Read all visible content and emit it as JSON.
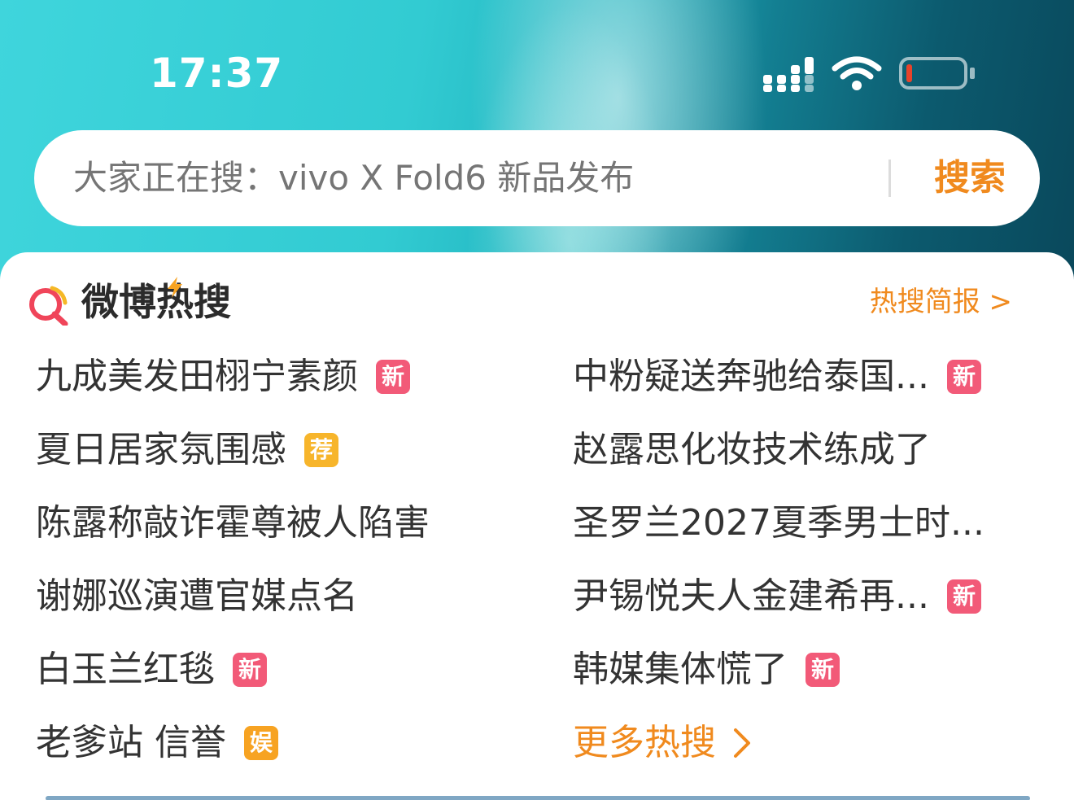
{
  "status_bar": {
    "time": "17:37",
    "icons": [
      "cellular-signal-icon",
      "wifi-icon",
      "battery-low-icon"
    ],
    "battery_color": "#e8432b"
  },
  "search": {
    "placeholder": "大家正在搜：vivo X Fold6 新品发布",
    "button_label": "搜索",
    "accent": "#f08a1e"
  },
  "hot_search": {
    "title": "微博热搜",
    "brief_link": "热搜简报 >",
    "more_label": "更多热搜",
    "left_items": [
      {
        "text": "九成美发田栩宁素颜",
        "badge": "新",
        "badge_type": "new"
      },
      {
        "text": "夏日居家氛围感",
        "badge": "荐",
        "badge_type": "rec"
      },
      {
        "text": "陈露称敲诈霍尊被人陷害",
        "badge": "",
        "badge_type": ""
      },
      {
        "text": "谢娜巡演遭官媒点名",
        "badge": "",
        "badge_type": ""
      },
      {
        "text": "白玉兰红毯",
        "badge": "新",
        "badge_type": "new"
      },
      {
        "text": "老爹站 信誉",
        "badge": "娱",
        "badge_type": "ent"
      }
    ],
    "right_items": [
      {
        "text": "中粉疑送奔驰给泰国...",
        "badge": "新",
        "badge_type": "new"
      },
      {
        "text": "赵露思化妆技术练成了",
        "badge": "",
        "badge_type": ""
      },
      {
        "text": "圣罗兰2027夏季男士时...",
        "badge": "",
        "badge_type": ""
      },
      {
        "text": "尹锡悦夫人金建希再...",
        "badge": "新",
        "badge_type": "new"
      },
      {
        "text": "韩媒集体慌了",
        "badge": "新",
        "badge_type": "new"
      }
    ],
    "badge_colors": {
      "new": "#f25a78",
      "rec": "#f7b52b",
      "ent": "#f7a322"
    }
  }
}
